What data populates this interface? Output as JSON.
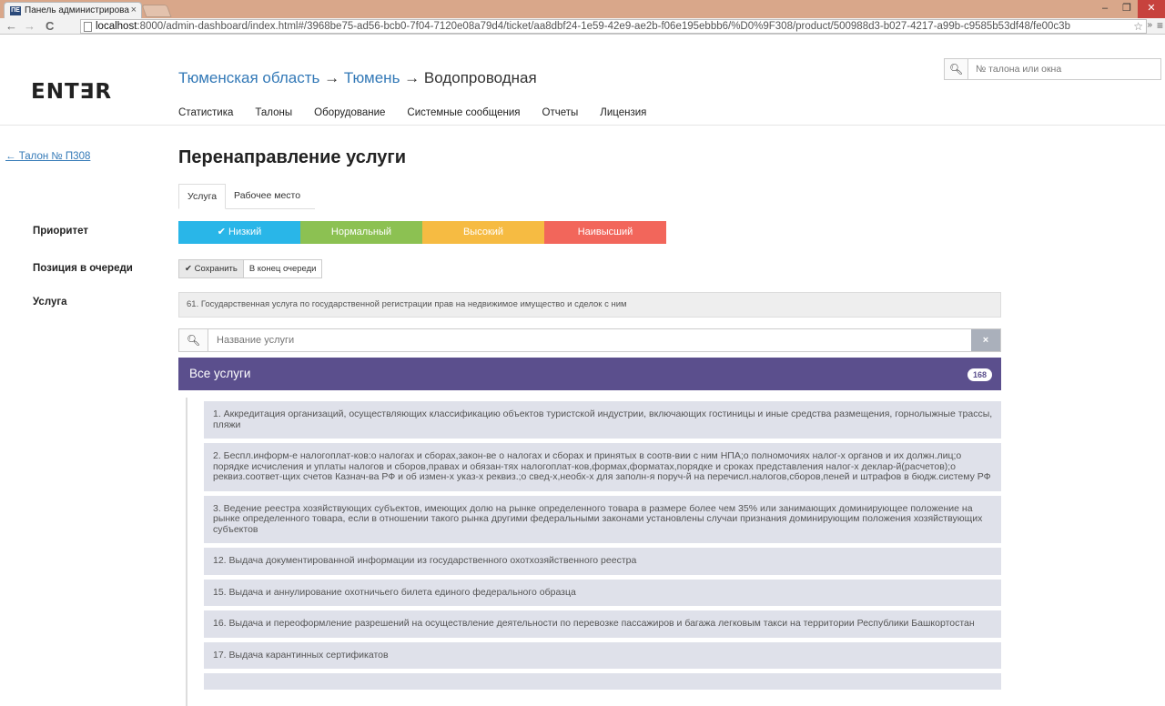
{
  "browser": {
    "tab_title": "Панель администрирова",
    "tab_favicon": "ПЕ",
    "url_host": "localhost",
    "url_rest": ":8000/admin-dashboard/index.html#/3968be75-ad56-bcb0-7f04-7120e08a79d4/ticket/aa8dbf24-1e59-42e9-ae2b-f06e195ebbb6/%D0%9F308/product/500988d3-b027-4217-a99b-c9585b53df48/fe00c3b"
  },
  "header": {
    "logo": "ENT∃R",
    "breadcrumb": {
      "region": "Тюменская область",
      "city": "Тюмень",
      "branch": "Водопроводная",
      "arrow": "→"
    },
    "nav": [
      "Статистика",
      "Талоны",
      "Оборудование",
      "Системные сообщения",
      "Отчеты",
      "Лицензия"
    ],
    "search_placeholder": "№ талона или окна"
  },
  "sidebar": {
    "back_link": "← Талон № П308",
    "labels": {
      "priority": "Приоритет",
      "queue_position": "Позиция в очереди",
      "service": "Услуга"
    }
  },
  "main": {
    "title": "Перенаправление услуги",
    "tabs": [
      {
        "label": "Услуга",
        "active": true
      },
      {
        "label": "Рабочее место",
        "active": false
      }
    ],
    "priority_options": [
      {
        "label": "✔ Низкий",
        "color": "#29b6e8",
        "selected": true
      },
      {
        "label": "Нормальный",
        "color": "#8cc152",
        "selected": false
      },
      {
        "label": "Высокий",
        "color": "#f6bb42",
        "selected": false
      },
      {
        "label": "Наивысший",
        "color": "#f2665b",
        "selected": false
      }
    ],
    "queue_options": [
      {
        "label": "✔ Сохранить",
        "active": true
      },
      {
        "label": "В конец очереди",
        "active": false
      }
    ],
    "selected_service": "61. Государственная услуга по государственной регистрации прав на недвижимое имущество и сделок с ним",
    "service_search_placeholder": "Название услуги",
    "all_services_label": "Все услуги",
    "all_services_count": "168",
    "accent_color": "#5b4f8d",
    "services": [
      "1. Аккредитация организаций, осуществляющих классификацию объектов туристской индустрии, включающих гостиницы и иные средства размещения, горнолыжные трассы, пляжи",
      "2. Беспл.информ-е налогоплат-ков:о налогах и сборах,закон-ве о налогах и сборах и принятых в соотв-вии с ним НПА;о полномочиях налог-х органов и их должн.лиц;о порядке исчисления и уплаты налогов и сборов,правах и обязан-тях налогоплат-ков,формах,форматах,порядке и сроках представления налог-х деклар-й(расчетов);о реквиз.соответ-щих счетов Казнач-ва РФ и об измен-х указ-х реквиз.;о свед-х,необх-х для заполн-я поруч-й на перечисл.налогов,сборов,пеней и штрафов в бюдж.систему РФ",
      "3. Ведение реестра хозяйствующих субъектов, имеющих долю на рынке определенного товара в размере более чем 35% или занимающих доминирующее положение на рынке определенного товара, если в отношении такого рынка другими федеральными законами установлены случаи признания доминирующим положения хозяйствующих субъектов",
      "12. Выдача документированной информации из государственного охотхозяйственного реестра",
      "15. Выдача и аннулирование охотничьего билета единого федерального образца",
      "16. Выдача и переоформление разрешений на осуществление деятельности по перевозке пассажиров и багажа легковым такси на территории Республики Башкортостан",
      "17. Выдача карантинных сертификатов",
      " "
    ]
  }
}
